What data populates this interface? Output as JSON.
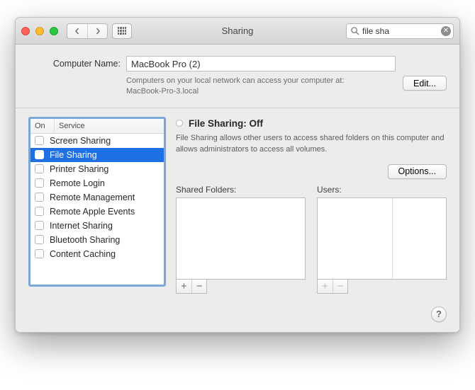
{
  "window": {
    "title": "Sharing"
  },
  "search": {
    "value": "file sha"
  },
  "top": {
    "computer_name_label": "Computer Name:",
    "computer_name_value": "MacBook Pro (2)",
    "note_line1": "Computers on your local network can access your computer at:",
    "note_line2": "MacBook-Pro-3.local",
    "edit_label": "Edit..."
  },
  "services": {
    "col_on": "On",
    "col_service": "Service",
    "items": [
      {
        "label": "Screen Sharing",
        "on": false,
        "selected": false
      },
      {
        "label": "File Sharing",
        "on": false,
        "selected": true
      },
      {
        "label": "Printer Sharing",
        "on": false,
        "selected": false
      },
      {
        "label": "Remote Login",
        "on": false,
        "selected": false
      },
      {
        "label": "Remote Management",
        "on": false,
        "selected": false
      },
      {
        "label": "Remote Apple Events",
        "on": false,
        "selected": false
      },
      {
        "label": "Internet Sharing",
        "on": false,
        "selected": false
      },
      {
        "label": "Bluetooth Sharing",
        "on": false,
        "selected": false
      },
      {
        "label": "Content Caching",
        "on": false,
        "selected": false
      }
    ]
  },
  "detail": {
    "status_title": "File Sharing: Off",
    "description": "File Sharing allows other users to access shared folders on this computer and allows administrators to access all volumes.",
    "options_label": "Options...",
    "shared_folders_label": "Shared Folders:",
    "users_label": "Users:",
    "plus": "+",
    "minus": "−"
  },
  "help": {
    "label": "?"
  }
}
